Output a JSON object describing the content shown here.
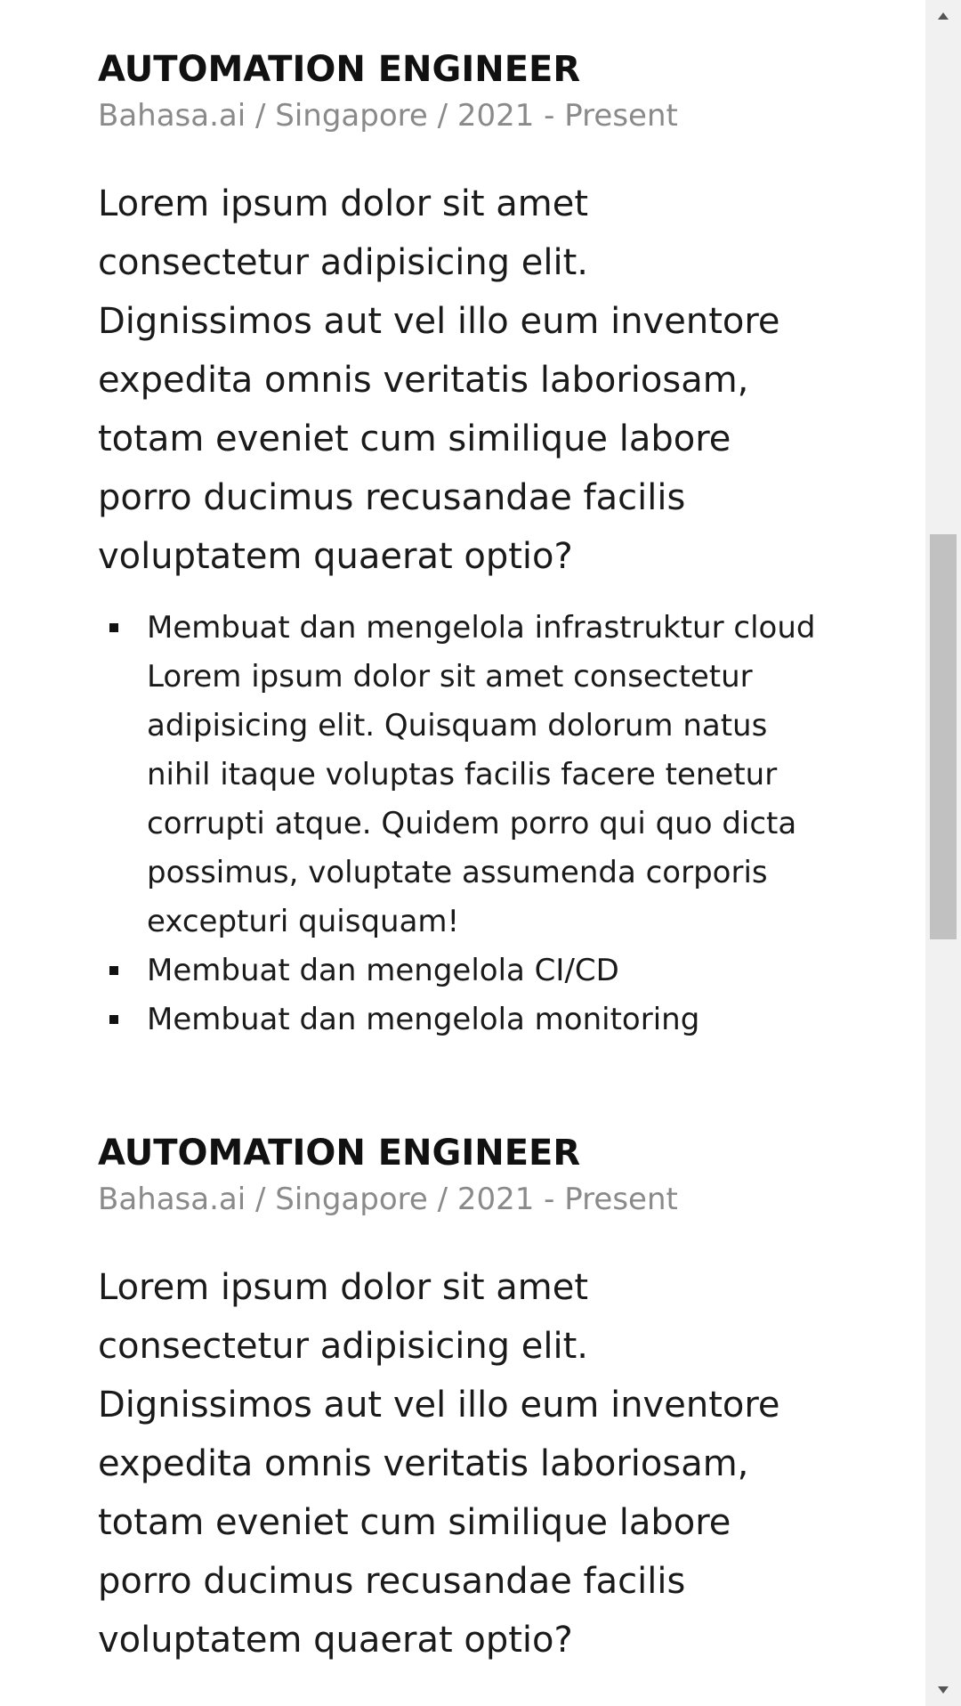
{
  "experience": [
    {
      "title": "AUTOMATION ENGINEER",
      "meta": "Bahasa.ai / Singapore / 2021 - Present",
      "description": "Lorem ipsum dolor sit amet consectetur adipisicing elit. Dignissimos aut vel illo eum inventore expedita omnis veritatis laboriosam, totam eveniet cum similique labore porro ducimus recusandae facilis voluptatem quaerat optio?",
      "bullets": [
        "Membuat dan mengelola infrastruktur cloud Lorem ipsum dolor sit amet consectetur adipisicing elit. Quisquam dolorum natus nihil itaque voluptas facilis facere tenetur corrupti atque. Quidem porro qui quo dicta possimus, voluptate assumenda corporis excepturi quisquam!",
        "Membuat dan mengelola CI/CD",
        "Membuat dan mengelola monitoring"
      ]
    },
    {
      "title": "AUTOMATION ENGINEER",
      "meta": "Bahasa.ai / Singapore / 2021 - Present",
      "description": "Lorem ipsum dolor sit amet consectetur adipisicing elit. Dignissimos aut vel illo eum inventore expedita omnis veritatis laboriosam, totam eveniet cum similique labore porro ducimus recusandae facilis voluptatem quaerat optio?"
    }
  ],
  "scrollbar": {
    "up_icon": "triangle-up-icon",
    "down_icon": "triangle-down-icon"
  }
}
